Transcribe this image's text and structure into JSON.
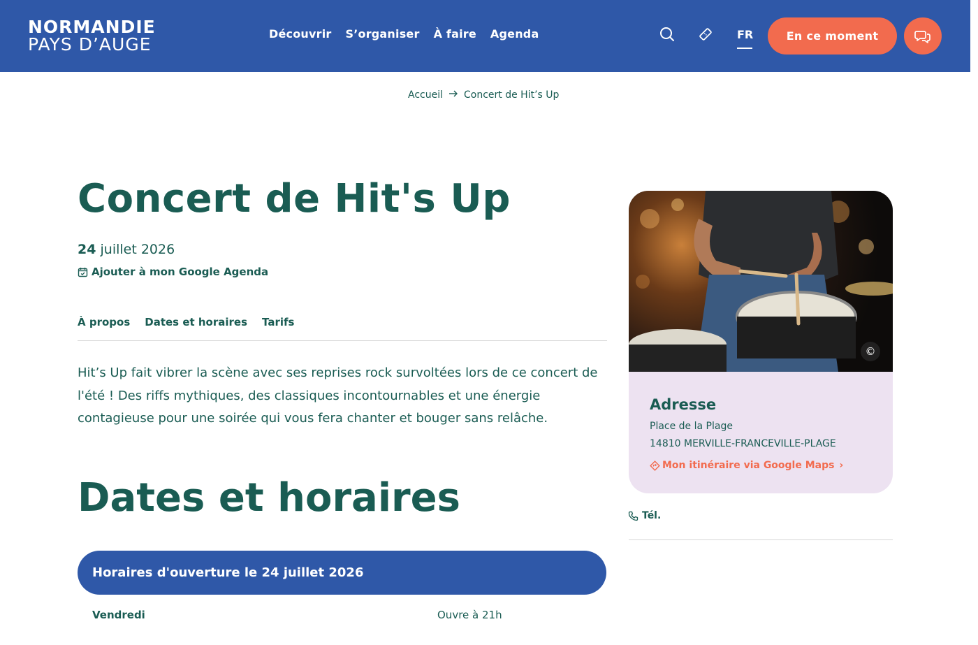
{
  "header": {
    "logo_line1": "NORMANDIE",
    "logo_line2": "PAYS D’AUGE",
    "nav": [
      "Découvrir",
      "S’organiser",
      "À faire",
      "Agenda"
    ],
    "lang": "FR",
    "cta": "En ce moment",
    "icons": [
      "search-icon",
      "ticket-icon",
      "chat-icon"
    ]
  },
  "breadcrumb": {
    "home": "Accueil",
    "current": "Concert de Hit’s Up"
  },
  "event": {
    "title": "Concert de Hit's Up",
    "date_day": "24",
    "date_rest": " juillet 2026",
    "gcal_label": "Ajouter à mon Google Agenda",
    "tabs": [
      "À propos",
      "Dates et horaires",
      "Tarifs"
    ],
    "description": "Hit’s Up fait vibrer la scène avec ses reprises rock survoltées lors de ce concert de l'été ! Des riffs mythiques, des classiques incontournables et une énergie contagieuse pour une soirée qui vous fera chanter et bouger sans relâche."
  },
  "schedule": {
    "heading": "Dates et horaires",
    "bar_label": "Horaires d'ouverture le 24 juillet 2026",
    "day": "Vendredi",
    "hours": "Ouvre à 21h"
  },
  "sidebar": {
    "copyright": "©",
    "address_title": "Adresse",
    "address_line1": "Place de la Plage",
    "address_line2": "14810 MERVILLE-FRANCEVILLE-PLAGE",
    "maps_link": "Mon itinéraire via Google Maps",
    "maps_chevron": "›",
    "tel_label": "Tél."
  },
  "colors": {
    "header_blue": "#2f58a8",
    "accent_orange": "#f26b4e",
    "text_green": "#1a5c53",
    "card_lilac": "#ede2f1"
  }
}
